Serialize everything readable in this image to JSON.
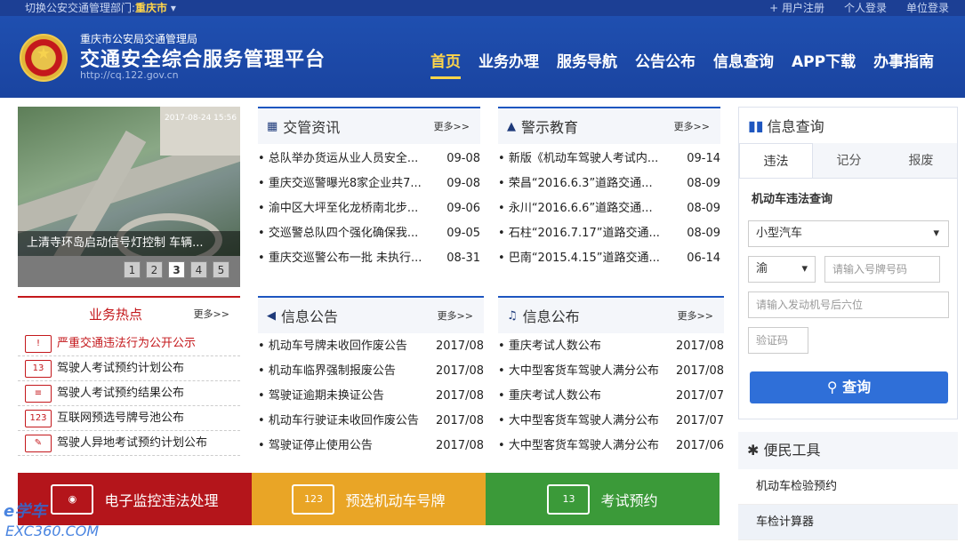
{
  "topbar": {
    "switch_label": "切换公安交通管理部门:",
    "city": "重庆市",
    "links": [
      "+ 用户注册",
      "个人登录",
      "单位登录"
    ]
  },
  "header": {
    "org": "重庆市公安局交通管理局",
    "site_name": "交通安全综合服务管理平台",
    "url": "http://cq.122.gov.cn"
  },
  "nav": [
    "首页",
    "业务办理",
    "服务导航",
    "公告公布",
    "信息查询",
    "APP下载",
    "办事指南"
  ],
  "banner": {
    "caption": "上清寺环岛启动信号灯控制 车辆...",
    "stamp": "2017-08-24 15:56",
    "pages": [
      "1",
      "2",
      "3",
      "4",
      "5"
    ],
    "active_page": "3"
  },
  "hot": {
    "title": "业务热点",
    "more": "更多>>",
    "items": [
      {
        "icon": "!",
        "label": "严重交通违法行为公开公示"
      },
      {
        "icon": "13",
        "label": "驾驶人考试预约计划公布"
      },
      {
        "icon": "≡",
        "label": "驾驶人考试预约结果公布"
      },
      {
        "icon": "123",
        "label": "互联网预选号牌号池公布"
      },
      {
        "icon": "✎",
        "label": "驾驶人异地考试预约计划公布"
      }
    ]
  },
  "news": {
    "title": "交管资讯",
    "more": "更多>>",
    "rows": [
      {
        "t": "总队举办货运从业人员安全...",
        "d": "09-08"
      },
      {
        "t": "重庆交巡警曝光8家企业共7...",
        "d": "09-08"
      },
      {
        "t": "渝中区大坪至化龙桥南北步...",
        "d": "09-06"
      },
      {
        "t": "交巡警总队四个强化确保我...",
        "d": "09-05"
      },
      {
        "t": "重庆交巡警公布一批 未执行...",
        "d": "08-31"
      }
    ]
  },
  "warn": {
    "title": "警示教育",
    "more": "更多>>",
    "rows": [
      {
        "t": "新版《机动车驾驶人考试内...",
        "d": "09-14"
      },
      {
        "t": "荣昌“2016.6.3”道路交通...",
        "d": "08-09"
      },
      {
        "t": "永川“2016.6.6”道路交通...",
        "d": "08-09"
      },
      {
        "t": "石柱“2016.7.17”道路交通...",
        "d": "08-09"
      },
      {
        "t": "巴南“2015.4.15”道路交通...",
        "d": "06-14"
      }
    ]
  },
  "notice": {
    "title": "信息公告",
    "more": "更多>>",
    "rows": [
      {
        "t": "机动车号牌未收回作废公告",
        "d": "2017/08"
      },
      {
        "t": "机动车临界强制报废公告",
        "d": "2017/08"
      },
      {
        "t": "驾驶证逾期未换证公告",
        "d": "2017/08"
      },
      {
        "t": "机动车行驶证未收回作废公告",
        "d": "2017/08"
      },
      {
        "t": "驾驶证停止使用公告",
        "d": "2017/08"
      }
    ]
  },
  "publish": {
    "title": "信息公布",
    "more": "更多>>",
    "rows": [
      {
        "t": "重庆考试人数公布",
        "d": "2017/08"
      },
      {
        "t": "大中型客货车驾驶人满分公布",
        "d": "2017/08"
      },
      {
        "t": "重庆考试人数公布",
        "d": "2017/07"
      },
      {
        "t": "大中型客货车驾驶人满分公布",
        "d": "2017/07"
      },
      {
        "t": "大中型客货车驾驶人满分公布",
        "d": "2017/06"
      }
    ]
  },
  "tiles": [
    {
      "label": "电子监控违法处理",
      "icon": "camera-icon",
      "color": "#b4151b",
      "glyph": "◉"
    },
    {
      "label": "预选机动车号牌",
      "icon": "plate-icon",
      "color": "#e9a526",
      "glyph": "123"
    },
    {
      "label": "考试预约",
      "icon": "calendar-icon",
      "color": "#3b9a39",
      "glyph": "13"
    }
  ],
  "query": {
    "title": "信息查询",
    "tabs": [
      "违法",
      "记分",
      "报废"
    ],
    "section": "机动车违法查询",
    "vehicle_type": "小型汽车",
    "province": "渝",
    "plate_placeholder": "请输入号牌号码",
    "engine_placeholder": "请输入发动机号后六位",
    "captcha_placeholder": "验证码",
    "button": "查询"
  },
  "tools": {
    "title": "便民工具",
    "items": [
      "机动车检验预约",
      "车检计算器"
    ]
  },
  "watermark": {
    "line1": "e学车",
    "line2": "EXC360.COM"
  }
}
